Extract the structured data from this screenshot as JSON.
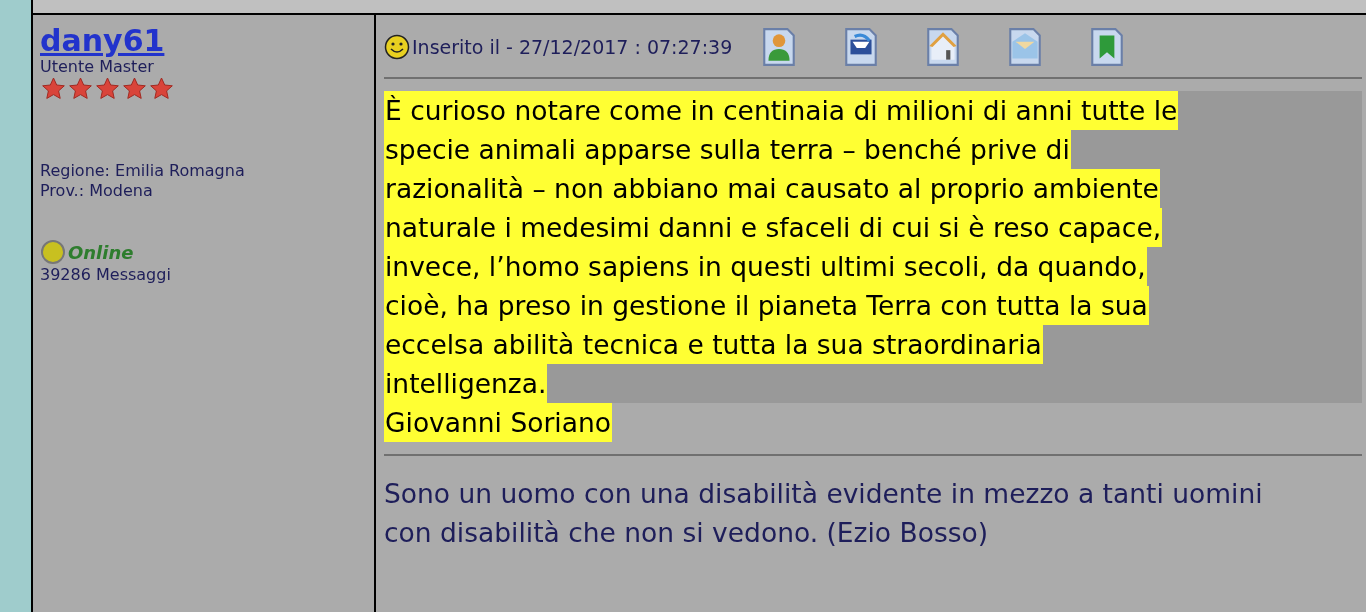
{
  "author": {
    "username": "dany61",
    "rank": "Utente Master",
    "stars": 5,
    "region": "Regione: Emilia Romagna",
    "province": "Prov.: Modena",
    "online": true,
    "status": "Online",
    "posts": "39286 Messaggi"
  },
  "post": {
    "posted": "Inserito il - 27/12/2017 : 07:27:39",
    "actions": [
      {
        "kind": "profile"
      },
      {
        "kind": "message"
      },
      {
        "kind": "home"
      },
      {
        "kind": "email"
      },
      {
        "kind": "bookmark"
      }
    ],
    "quote_lines": [
      "È curioso notare come in centinaia di milioni di anni tutte le",
      "specie animali apparse sulla terra – benché prive di",
      "razionalità – non abbiano mai causato al proprio ambiente",
      "naturale i medesimi danni e sfaceli di cui si è reso capace,",
      "invece, l’homo sapiens in questi ultimi secoli, da quando,",
      "cioè, ha preso in gestione il pianeta Terra con tutta la sua",
      "eccelsa abilità tecnica e tutta la sua straordinaria",
      "intelligenza."
    ],
    "quote_author": "Giovanni Soriano",
    "signature": "Sono un uomo con una disabilità evidente in mezzo a tanti uomini con disabilità che non si vedono. (Ezio Bosso)"
  }
}
